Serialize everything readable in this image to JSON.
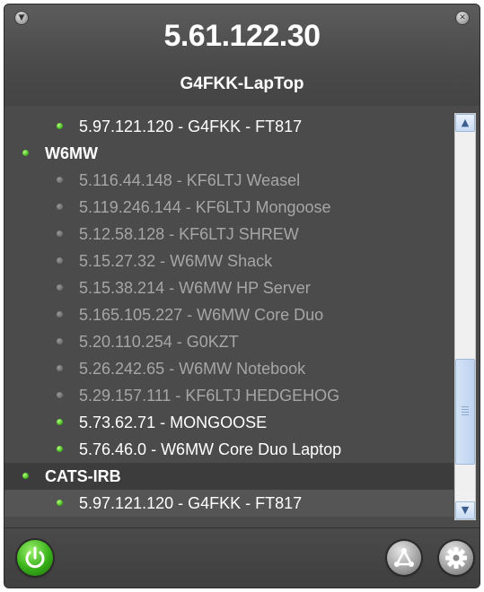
{
  "header": {
    "ip_address": "5.61.122.30",
    "hostname": "G4FKK-LapTop"
  },
  "list": {
    "rows": [
      {
        "kind": "child",
        "status": "online",
        "label": "5.97.121.120 - G4FKK - FT817"
      },
      {
        "kind": "group",
        "status": "online",
        "label": "W6MW"
      },
      {
        "kind": "child",
        "status": "offline",
        "label": "5.116.44.148 - KF6LTJ Weasel"
      },
      {
        "kind": "child",
        "status": "offline",
        "label": "5.119.246.144 - KF6LTJ Mongoose"
      },
      {
        "kind": "child",
        "status": "offline",
        "label": "5.12.58.128 - KF6LTJ SHREW"
      },
      {
        "kind": "child",
        "status": "offline",
        "label": "5.15.27.32 - W6MW Shack"
      },
      {
        "kind": "child",
        "status": "offline",
        "label": "5.15.38.214 - W6MW HP Server"
      },
      {
        "kind": "child",
        "status": "offline",
        "label": "5.165.105.227 - W6MW Core Duo"
      },
      {
        "kind": "child",
        "status": "offline",
        "label": "5.20.110.254 - G0KZT"
      },
      {
        "kind": "child",
        "status": "offline",
        "label": "5.26.242.65 - W6MW Notebook"
      },
      {
        "kind": "child",
        "status": "offline",
        "label": "5.29.157.111 - KF6LTJ HEDGEHOG"
      },
      {
        "kind": "child",
        "status": "online",
        "label": "5.73.62.71 - MONGOOSE"
      },
      {
        "kind": "child",
        "status": "online",
        "label": "5.76.46.0 - W6MW Core Duo Laptop"
      },
      {
        "kind": "group",
        "status": "online",
        "label": "CATS-IRB"
      },
      {
        "kind": "child",
        "status": "online",
        "label": "5.97.121.120 - G4FKK - FT817"
      }
    ]
  },
  "scrollbar": {
    "position_fraction": 0.86
  },
  "footer": {
    "icons": [
      "power-icon",
      "network-icon",
      "gear-icon"
    ]
  },
  "colors": {
    "online": "#3fb11d",
    "offline": "#6c6c6c",
    "background": "#474747",
    "text": "#ffffff",
    "dim_text": "#a6a6a6"
  }
}
